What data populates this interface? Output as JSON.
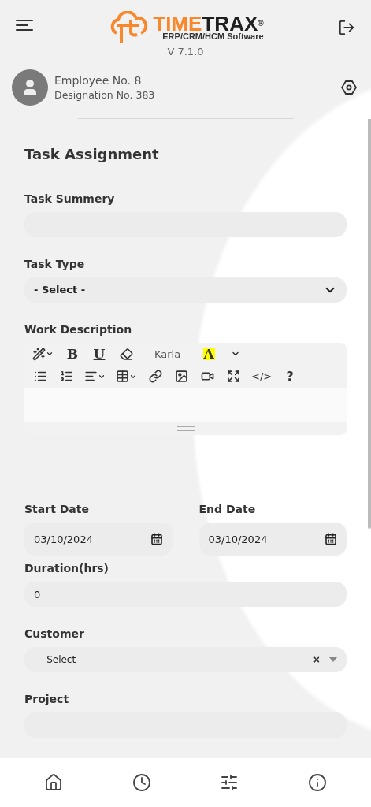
{
  "header": {
    "brand_left": "TIME",
    "brand_right": "TRAX",
    "registered": "®",
    "tagline": "ERP/CRM/HCM Software",
    "version": "V 7.1.0"
  },
  "profile": {
    "name": "Employee No. 8",
    "designation": "Designation No. 383"
  },
  "form": {
    "title": "Task Assignment",
    "summary": {
      "label": "Task Summery"
    },
    "task_type": {
      "label": "Task Type",
      "value": "- Select -"
    },
    "description": {
      "label": "Work Description",
      "toolbar": [
        [
          {
            "kind": "icon"
          },
          {
            "kind": "glyph",
            "text": "B"
          },
          {
            "kind": "glyph",
            "text": "U"
          },
          {
            "kind": "icon"
          },
          {
            "kind": "font",
            "text": "Karla"
          },
          {
            "kind": "glyph",
            "text": "A"
          },
          {
            "kind": "icon"
          }
        ],
        [
          {
            "kind": "icon"
          },
          {
            "kind": "icon"
          },
          {
            "kind": "icon"
          },
          {
            "kind": "icon"
          },
          {
            "kind": "icon"
          },
          {
            "kind": "icon"
          },
          {
            "kind": "icon"
          },
          {
            "kind": "icon"
          },
          {
            "kind": "glyph",
            "text": "</>"
          },
          {
            "kind": "glyph",
            "text": "?"
          }
        ]
      ]
    },
    "start_date": {
      "label": "Start Date",
      "value": "03/10/2024"
    },
    "end_date": {
      "label": "End Date",
      "value": "03/10/2024"
    },
    "duration": {
      "label": "Duration(hrs)",
      "value": "0"
    },
    "customer": {
      "label": "Customer",
      "value": "- Select -",
      "clear": "×"
    },
    "project": {
      "label": "Project"
    }
  }
}
